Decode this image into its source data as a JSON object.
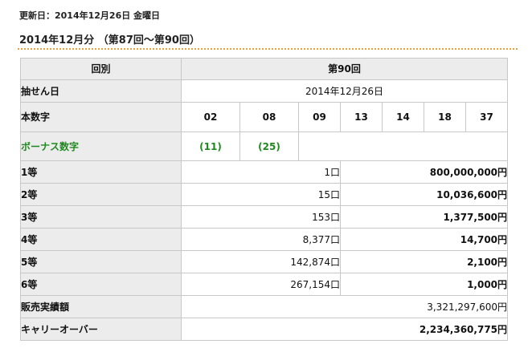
{
  "updated": "更新日：2014年12月26日 金曜日",
  "period": "2014年12月分 （第87回～第90回）",
  "table": {
    "round_label": "回別",
    "round_value": "第90回",
    "draw_date_label": "抽せん日",
    "draw_date_value": "2014年12月26日",
    "main_numbers_label": "本数字",
    "main_numbers": [
      "02",
      "08",
      "09",
      "13",
      "14",
      "18",
      "37"
    ],
    "bonus_label": "ボーナス数字",
    "bonus_numbers": [
      "(11)",
      "(25)"
    ],
    "prizes": [
      {
        "tier": "1等",
        "count": "1口",
        "amount": "800,000,000円"
      },
      {
        "tier": "2等",
        "count": "15口",
        "amount": "10,036,600円"
      },
      {
        "tier": "3等",
        "count": "153口",
        "amount": "1,377,500円"
      },
      {
        "tier": "4等",
        "count": "8,377口",
        "amount": "14,700円"
      },
      {
        "tier": "5等",
        "count": "142,874口",
        "amount": "2,100円"
      },
      {
        "tier": "6等",
        "count": "267,154口",
        "amount": "1,000円"
      }
    ],
    "sales_label": "販売実績額",
    "sales_value": "3,321,297,600円",
    "carryover_label": "キャリーオーバー",
    "carryover_value": "2,234,360,775円"
  },
  "colors": {
    "header_bg": "#ececec",
    "bonus_green": "#1f8a1f",
    "dotted_rule": "#e6a23a",
    "border": "#c8c8c8"
  }
}
